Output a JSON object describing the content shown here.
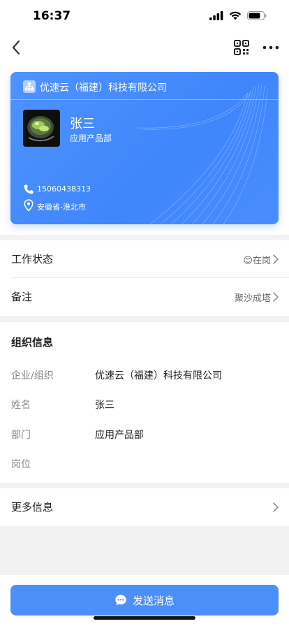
{
  "status_bar": {
    "time": "16:37"
  },
  "nav": {
    "back_icon": "chevron-left-icon",
    "qr_icon": "qr-code-icon",
    "more_icon": "more-dots-icon"
  },
  "card": {
    "org": "优速云（福建）科技有限公司",
    "name": "张三",
    "department": "应用产品部",
    "phone": "15060438313",
    "location": "安徽省-淮北市",
    "accent": "#4a8dff"
  },
  "rows": {
    "work_status": {
      "label": "工作状态",
      "value": "在岗",
      "emoji": "😊"
    },
    "remark": {
      "label": "备注",
      "value": "聚沙成塔"
    }
  },
  "org_info": {
    "title": "组织信息",
    "items": [
      {
        "key": "企业/组织",
        "value": "优速云（福建）科技有限公司"
      },
      {
        "key": "姓名",
        "value": "张三"
      },
      {
        "key": "部门",
        "value": "应用产品部"
      },
      {
        "key": "岗位",
        "value": ""
      }
    ]
  },
  "more_info": {
    "label": "更多信息"
  },
  "send_button": {
    "label": "发送消息",
    "icon": "chat-bubble-icon"
  }
}
